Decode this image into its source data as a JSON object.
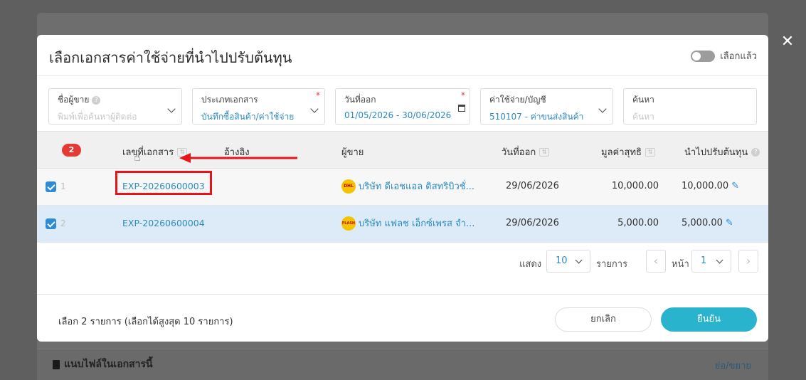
{
  "background": {
    "attach_label": "แนบไฟล์ในเอกสารนี้",
    "toggle_link": "ย่อ/ขยาย"
  },
  "modal": {
    "title": "เลือกเอกสารค่าใช้จ่ายที่นำไปปรับต้นทุน",
    "switch_label": "เลือกแล้ว",
    "filters": {
      "seller": {
        "label": "ชื่อผู้ขาย",
        "placeholder": "พิมพ์เพื่อค้นหาผู้ติดต่อ"
      },
      "doc_type": {
        "label": "ประเภทเอกสาร",
        "value": "บันทึกซื้อสินค้า/ค่าใช้จ่าย"
      },
      "issue_date": {
        "label": "วันที่ออก",
        "value": "01/05/2026 - 30/06/2026"
      },
      "account": {
        "label": "ค่าใช้จ่าย/บัญชี",
        "value": "510107 - ค่าขนส่งสินค้า"
      },
      "search": {
        "label": "ค้นหา",
        "placeholder": "ค้นหา"
      }
    },
    "table": {
      "selected_count": "2",
      "headers": {
        "doc_no": "เลขที่เอกสาร",
        "reference": "อ้างอิง",
        "seller": "ผู้ขาย",
        "issue_date": "วันที่ออก",
        "net_value": "มูลค่าสุทธิ",
        "adjust": "นำไปปรับต้นทุน"
      },
      "rows": [
        {
          "num": "1",
          "doc_no": "EXP-20260600003",
          "seller": "บริษัท ดีเอชแอล ดิสทริบิวชั่...",
          "seller_logo": "DHL",
          "date": "29/06/2026",
          "net": "10,000.00",
          "adjust": "10,000.00"
        },
        {
          "num": "2",
          "doc_no": "EXP-20260600004",
          "seller": "บริษัท แฟลช เอ็กซ์เพรส จำ...",
          "seller_logo": "FLASH",
          "date": "29/06/2026",
          "net": "5,000.00",
          "adjust": "5,000.00"
        }
      ]
    },
    "pager": {
      "show_label": "แสดง",
      "page_size": "10",
      "items_label": "รายการ",
      "page_label": "หน้า",
      "page": "1"
    },
    "footer": {
      "info": "เลือก 2 รายการ (เลือกได้สูงสุด 10 รายการ)",
      "cancel": "ยกเลิก",
      "confirm": "ยืนยัน"
    }
  },
  "colors": {
    "accent": "#2ab3cc",
    "link": "#2e8bc0",
    "highlight": "#e8141c",
    "selected_row": "#dcebf7"
  }
}
